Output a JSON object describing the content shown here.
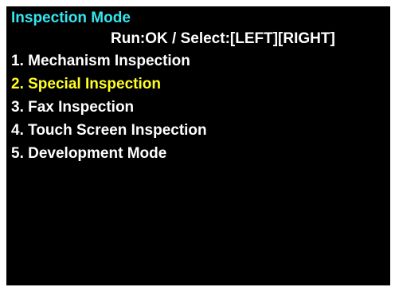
{
  "screen": {
    "title": "Inspection Mode",
    "instructions": "Run:OK / Select:[LEFT][RIGHT]",
    "selected_index": 1,
    "menu": [
      {
        "label": "1. Mechanism Inspection"
      },
      {
        "label": "2. Special Inspection"
      },
      {
        "label": "3. Fax Inspection"
      },
      {
        "label": "4. Touch Screen Inspection"
      },
      {
        "label": "5. Development Mode"
      }
    ]
  },
  "colors": {
    "background": "#000000",
    "title": "#33e6f0",
    "text": "#ffffff",
    "selected": "#ffff24"
  }
}
